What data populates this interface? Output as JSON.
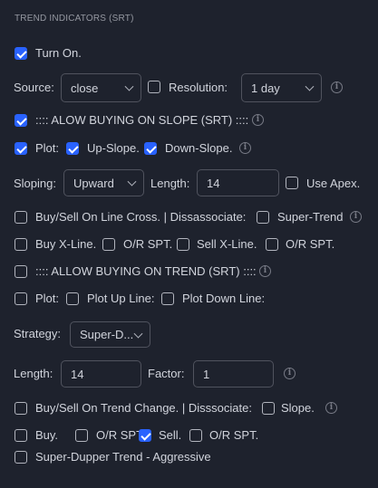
{
  "section_title": "TREND INDICATORS (SRT)",
  "turn_on": {
    "label": "Turn On.",
    "checked": true
  },
  "source": {
    "label": "Source:",
    "value": "close"
  },
  "resolution": {
    "label": "Resolution:",
    "checked": false,
    "value": "1 day"
  },
  "slope_section": {
    "label": ":::: ALOW BUYING ON SLOPE (SRT) ::::",
    "checked": true
  },
  "plot_row": {
    "plot_label": "Plot:",
    "up_slope_label": "Up-Slope.",
    "down_slope_label": "Down-Slope."
  },
  "sloping": {
    "label": "Sloping:",
    "value": "Upward",
    "length_label": "Length:",
    "length_value": "14",
    "use_apex_label": "Use Apex."
  },
  "line_cross": {
    "label": "Buy/Sell On Line Cross. | Dissassociate:",
    "super_trend_label": "Super-Trend"
  },
  "xline_row": {
    "buy_label": "Buy X-Line.",
    "or_spt_1": "O/R SPT.",
    "sell_label": "Sell X-Line.",
    "or_spt_2": "O/R SPT."
  },
  "trend_section": {
    "label": ":::: ALLOW BUYING ON TREND (SRT) ::::",
    "checked": false
  },
  "plot_trend_row": {
    "plot_label": "Plot:",
    "up_line_label": "Plot Up Line:",
    "down_line_label": "Plot Down Line:"
  },
  "strategy": {
    "label": "Strategy:",
    "value": "Super-D..."
  },
  "length_factor": {
    "length_label": "Length:",
    "length_value": "14",
    "factor_label": "Factor:",
    "factor_value": "1"
  },
  "trend_change": {
    "label": "Buy/Sell On Trend Change. | Disssociate:",
    "slope_label": "Slope."
  },
  "buy_sell_row": {
    "buy_label": "Buy.",
    "or_spt_1": "O/R SPT.",
    "sell_label": "Sell.",
    "or_spt_2": "O/R SPT."
  },
  "aggressive": {
    "label": "Super-Dupper Trend - Aggressive"
  },
  "icons": {
    "info": "info-icon",
    "dropdown": "chevron-down-icon",
    "check": "checkmark-icon"
  },
  "colors": {
    "background": "#1e222d",
    "accent": "#2962ff",
    "text": "#d1d4dc",
    "border": "#50535e"
  }
}
